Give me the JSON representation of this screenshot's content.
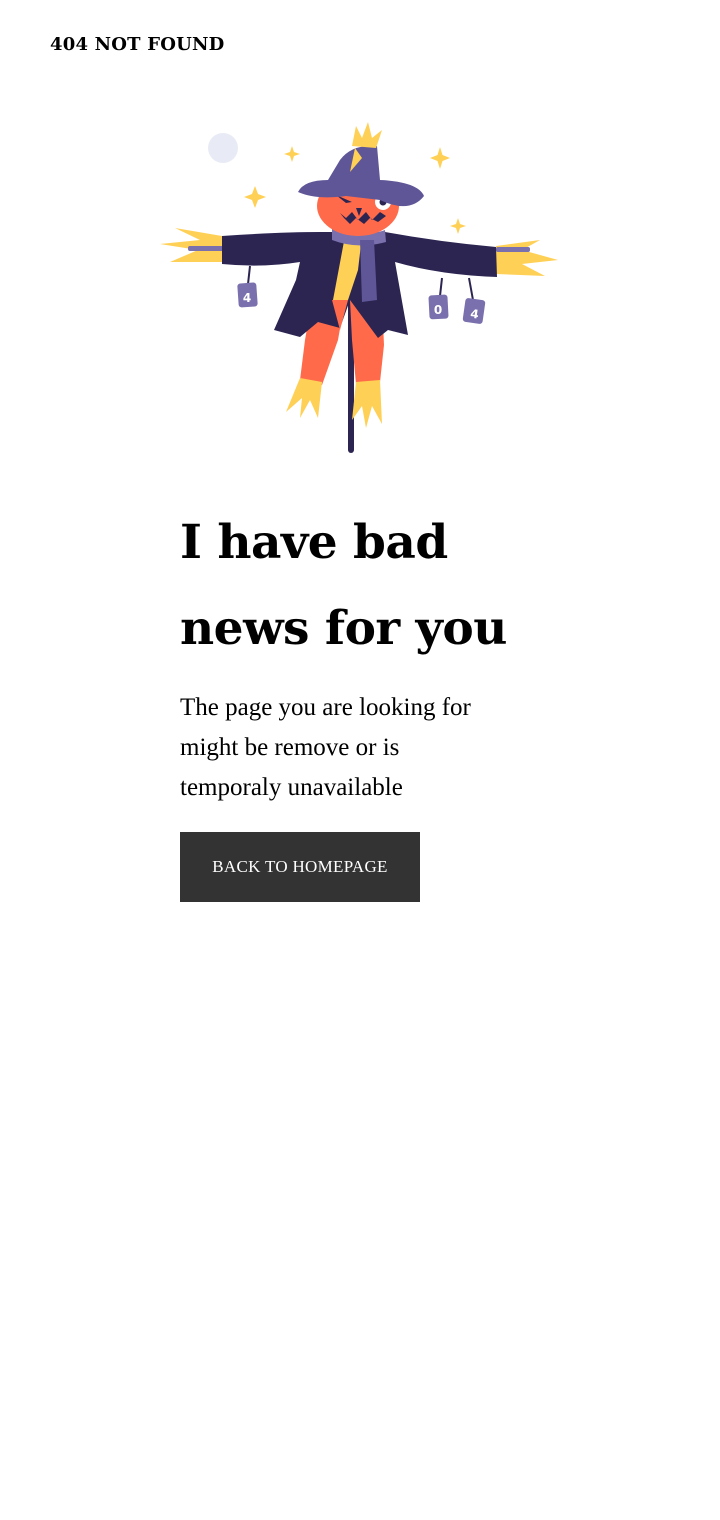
{
  "header": {
    "brand": "404 NOT FOUND"
  },
  "illustration": {
    "icon": "scarecrow-illustration",
    "can_labels": [
      "4",
      "0",
      "4"
    ]
  },
  "main": {
    "headline_line1": "I have bad",
    "headline_line2": "news for you",
    "message_line1": "The page you are looking for",
    "message_line2": "might be remove or is",
    "message_line3": "temporaly unavailable",
    "button_label": "BACK TO HOMEPAGE"
  },
  "colors": {
    "button_bg": "#333333",
    "coat": "#2c2451",
    "hat": "#5f5697",
    "face": "#ff6b4a",
    "straw": "#ffd056",
    "moon": "#e8ebf5"
  }
}
